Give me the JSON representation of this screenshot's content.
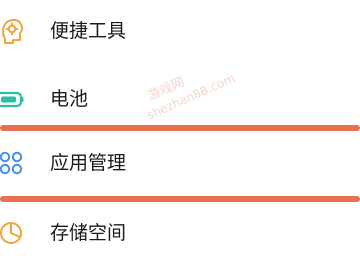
{
  "settings": {
    "items": [
      {
        "label": "便捷工具",
        "icon": "accessibility-head-icon",
        "icon_color": "#f0a43a"
      },
      {
        "label": "电池",
        "icon": "battery-icon",
        "icon_color": "#28bfa2"
      },
      {
        "label": "应用管理",
        "icon": "app-grid-icon",
        "icon_color": "#3f8ef0"
      },
      {
        "label": "存储空间",
        "icon": "storage-pie-icon",
        "icon_color": "#f0a43a"
      }
    ]
  },
  "highlight_color": "#e8704f",
  "watermark": {
    "line1": "游戏网",
    "line2": "shezhan88.com"
  }
}
